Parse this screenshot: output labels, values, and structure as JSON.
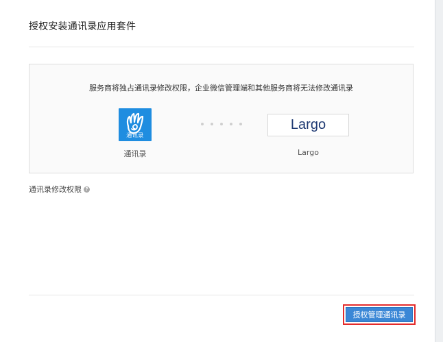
{
  "dialog": {
    "title": "授权安装通讯录应用套件",
    "panel": {
      "notice": "服务商将独占通讯录修改权限，企业微信管理端和其他服务商将无法修改通讯录",
      "left_app": {
        "icon_badge": "通讯录",
        "name": "通讯录",
        "icon": "hand-swirl-icon",
        "color": "#1f8de0"
      },
      "right_app": {
        "logo_text": "Largo",
        "name": "Largo",
        "color": "#1f3a73"
      }
    },
    "permission_label": "通讯录修改权限",
    "help_icon": "?",
    "primary_button": {
      "label": "授权管理通讯录",
      "color": "#3a87d6",
      "highlight_color": "#e32b2b"
    }
  }
}
